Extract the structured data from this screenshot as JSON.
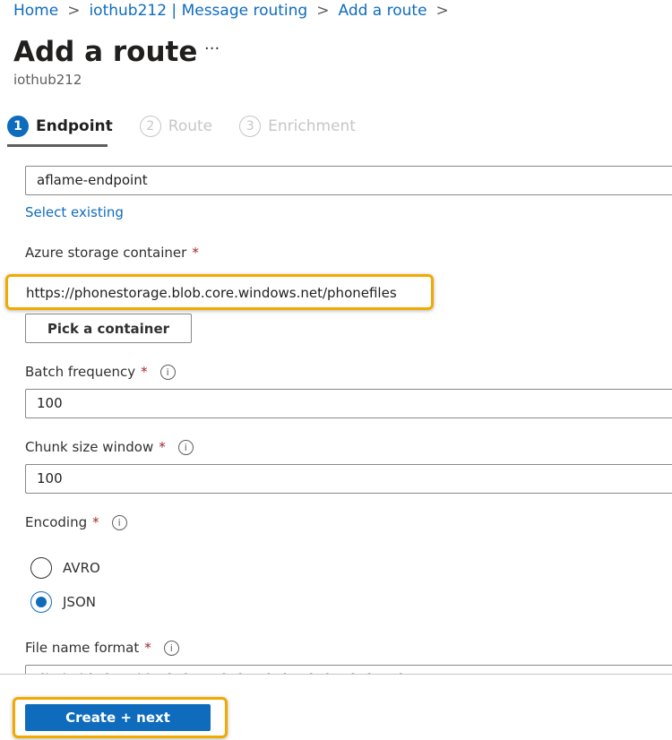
{
  "breadcrumb": {
    "items": [
      "Home",
      "iothub212 | Message routing",
      "Add a route"
    ],
    "separator": ">"
  },
  "header": {
    "title": "Add a route",
    "more": "···",
    "subtitle": "iothub212"
  },
  "steps": [
    {
      "num": "1",
      "label": "Endpoint",
      "active": true
    },
    {
      "num": "2",
      "label": "Route"
    },
    {
      "num": "3",
      "label": "Enrichment"
    }
  ],
  "form": {
    "endpoint_name": "aflame-endpoint",
    "select_existing": "Select existing",
    "container_label": "Azure storage container",
    "container_value": "https://phonestorage.blob.core.windows.net/phonefiles",
    "pick_container": "Pick a container",
    "batch_label": "Batch frequency",
    "batch_value": "100",
    "chunk_label": "Chunk size window",
    "chunk_value": "100",
    "encoding_label": "Encoding",
    "encoding_options": [
      "AVRO",
      "JSON"
    ],
    "encoding_selected": "JSON",
    "filename_label": "File name format",
    "filename_value": "{iothub}/{partition}/{YYYY}/{MM}/{DD}/{HH}/{mm}",
    "required": "*",
    "info": "i"
  },
  "footer": {
    "create_next": "Create + next"
  },
  "colors": {
    "accent": "#0f6cbd",
    "highlight": "#f2a900"
  }
}
